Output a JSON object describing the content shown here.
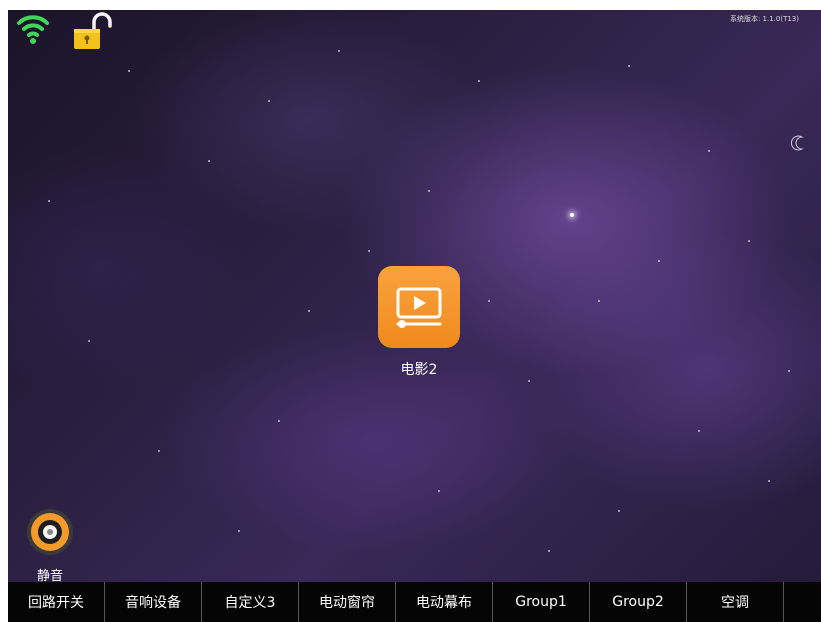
{
  "status": {
    "wifi_icon": "wifi-icon",
    "lock_icon": "unlocked-padlock-icon",
    "version": "系统版本: 1.1.0(T13)"
  },
  "main": {
    "scene": {
      "icon": "movie-play-icon",
      "label": "电影2",
      "accent": "#f4951f"
    }
  },
  "mute": {
    "icon": "speaker-icon",
    "label": "静音"
  },
  "tabs": [
    {
      "label": "回路开关"
    },
    {
      "label": "音响设备"
    },
    {
      "label": "自定义3"
    },
    {
      "label": "电动窗帘"
    },
    {
      "label": "电动幕布"
    },
    {
      "label": "Group1"
    },
    {
      "label": "Group2"
    },
    {
      "label": "空调"
    }
  ]
}
